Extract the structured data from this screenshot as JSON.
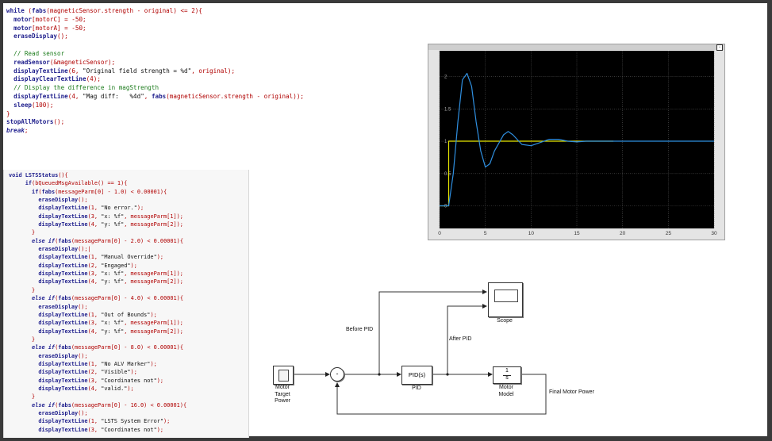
{
  "code_block_1": {
    "lines": [
      [
        {
          "t": "while",
          "c": "kw"
        },
        {
          "t": " (",
          "c": "op"
        },
        {
          "t": "fabs",
          "c": "fn"
        },
        {
          "t": "(magneticSensor.strength - original) <= ",
          "c": "op"
        },
        {
          "t": "2",
          "c": "num"
        },
        {
          "t": "){",
          "c": "op"
        }
      ],
      [
        {
          "t": "  motor",
          "c": "fn"
        },
        {
          "t": "[motorC]",
          "c": "op"
        },
        {
          "t": " = -",
          "c": "op"
        },
        {
          "t": "50",
          "c": "num"
        },
        {
          "t": ";",
          "c": "op"
        }
      ],
      [
        {
          "t": "  motor",
          "c": "fn"
        },
        {
          "t": "[motorA]",
          "c": "op"
        },
        {
          "t": " = -",
          "c": "op"
        },
        {
          "t": "50",
          "c": "num"
        },
        {
          "t": ";",
          "c": "op"
        }
      ],
      [
        {
          "t": "  eraseDisplay",
          "c": "fn"
        },
        {
          "t": "();",
          "c": "op"
        }
      ],
      [
        {
          "t": "",
          "c": "op"
        }
      ],
      [
        {
          "t": "  // Read sensor",
          "c": "cm"
        }
      ],
      [
        {
          "t": "  readSensor",
          "c": "fn"
        },
        {
          "t": "(&magneticSensor);",
          "c": "op"
        }
      ],
      [
        {
          "t": "  displayTextLine",
          "c": "fn"
        },
        {
          "t": "(",
          "c": "op"
        },
        {
          "t": "6",
          "c": "num"
        },
        {
          "t": ", ",
          "c": "op"
        },
        {
          "t": "\"Original field strength = %d\"",
          "c": "str"
        },
        {
          "t": ", original);",
          "c": "op"
        }
      ],
      [
        {
          "t": "  displayClearTextLine",
          "c": "fn"
        },
        {
          "t": "(",
          "c": "op"
        },
        {
          "t": "4",
          "c": "num"
        },
        {
          "t": ");",
          "c": "op"
        }
      ],
      [
        {
          "t": "  // Display the difference in magStrength",
          "c": "cm"
        }
      ],
      [
        {
          "t": "  displayTextLine",
          "c": "fn"
        },
        {
          "t": "(",
          "c": "op"
        },
        {
          "t": "4",
          "c": "num"
        },
        {
          "t": ", ",
          "c": "op"
        },
        {
          "t": "\"Mag diff:   %4d\"",
          "c": "str"
        },
        {
          "t": ", ",
          "c": "op"
        },
        {
          "t": "fabs",
          "c": "fn"
        },
        {
          "t": "(magneticSensor.strength - original));",
          "c": "op"
        }
      ],
      [
        {
          "t": "  sleep",
          "c": "fn"
        },
        {
          "t": "(",
          "c": "op"
        },
        {
          "t": "100",
          "c": "num"
        },
        {
          "t": ");",
          "c": "op"
        }
      ],
      [
        {
          "t": "}",
          "c": "op"
        }
      ],
      [
        {
          "t": "stopAllMotors",
          "c": "fn"
        },
        {
          "t": "();",
          "c": "op"
        }
      ],
      [
        {
          "t": "break",
          "c": "kwi"
        },
        {
          "t": ";",
          "c": "op"
        }
      ]
    ]
  },
  "code_block_2": {
    "lines": [
      [
        {
          "t": "void ",
          "c": "kw"
        },
        {
          "t": "LSTSStatus",
          "c": "fn"
        },
        {
          "t": "(){",
          "c": "op"
        }
      ],
      [
        {
          "t": "     if",
          "c": "kw"
        },
        {
          "t": "(bQueuedMsgAvailable() == ",
          "c": "op"
        },
        {
          "t": "1",
          "c": "num"
        },
        {
          "t": "){",
          "c": "op"
        }
      ],
      [
        {
          "t": "       if",
          "c": "kw"
        },
        {
          "t": "(",
          "c": "op"
        },
        {
          "t": "fabs",
          "c": "fn"
        },
        {
          "t": "(messageParm[",
          "c": "op"
        },
        {
          "t": "0",
          "c": "num"
        },
        {
          "t": "] - ",
          "c": "op"
        },
        {
          "t": "1.0",
          "c": "num"
        },
        {
          "t": ") < ",
          "c": "op"
        },
        {
          "t": "0.00001",
          "c": "num"
        },
        {
          "t": "){",
          "c": "op"
        }
      ],
      [
        {
          "t": "         eraseDisplay",
          "c": "fn"
        },
        {
          "t": "();",
          "c": "op"
        }
      ],
      [
        {
          "t": "         displayTextLine",
          "c": "fn"
        },
        {
          "t": "(",
          "c": "op"
        },
        {
          "t": "1",
          "c": "num"
        },
        {
          "t": ", ",
          "c": "op"
        },
        {
          "t": "\"No error.\"",
          "c": "str"
        },
        {
          "t": ");",
          "c": "op"
        }
      ],
      [
        {
          "t": "         displayTextLine",
          "c": "fn"
        },
        {
          "t": "(",
          "c": "op"
        },
        {
          "t": "3",
          "c": "num"
        },
        {
          "t": ", ",
          "c": "op"
        },
        {
          "t": "\"x: %f\"",
          "c": "str"
        },
        {
          "t": ", messageParm[",
          "c": "op"
        },
        {
          "t": "1",
          "c": "num"
        },
        {
          "t": "]);",
          "c": "op"
        }
      ],
      [
        {
          "t": "         displayTextLine",
          "c": "fn"
        },
        {
          "t": "(",
          "c": "op"
        },
        {
          "t": "4",
          "c": "num"
        },
        {
          "t": ", ",
          "c": "op"
        },
        {
          "t": "\"y: %f\"",
          "c": "str"
        },
        {
          "t": ", messageParm[",
          "c": "op"
        },
        {
          "t": "2",
          "c": "num"
        },
        {
          "t": "]);",
          "c": "op"
        }
      ],
      [
        {
          "t": "       }",
          "c": "op"
        }
      ],
      [
        {
          "t": "       else if",
          "c": "kwi"
        },
        {
          "t": "(",
          "c": "op"
        },
        {
          "t": "fabs",
          "c": "fn"
        },
        {
          "t": "(messageParm[",
          "c": "op"
        },
        {
          "t": "0",
          "c": "num"
        },
        {
          "t": "] - ",
          "c": "op"
        },
        {
          "t": "2.0",
          "c": "num"
        },
        {
          "t": ") < ",
          "c": "op"
        },
        {
          "t": "0.00001",
          "c": "num"
        },
        {
          "t": "){",
          "c": "op"
        }
      ],
      [
        {
          "t": "         eraseDisplay",
          "c": "fn"
        },
        {
          "t": "();|",
          "c": "op"
        }
      ],
      [
        {
          "t": "         displayTextLine",
          "c": "fn"
        },
        {
          "t": "(",
          "c": "op"
        },
        {
          "t": "1",
          "c": "num"
        },
        {
          "t": ", ",
          "c": "op"
        },
        {
          "t": "\"Manual Override\"",
          "c": "str"
        },
        {
          "t": ");",
          "c": "op"
        }
      ],
      [
        {
          "t": "         displayTextLine",
          "c": "fn"
        },
        {
          "t": "(",
          "c": "op"
        },
        {
          "t": "2",
          "c": "num"
        },
        {
          "t": ", ",
          "c": "op"
        },
        {
          "t": "\"Engaged\"",
          "c": "str"
        },
        {
          "t": ");",
          "c": "op"
        }
      ],
      [
        {
          "t": "         displayTextLine",
          "c": "fn"
        },
        {
          "t": "(",
          "c": "op"
        },
        {
          "t": "3",
          "c": "num"
        },
        {
          "t": ", ",
          "c": "op"
        },
        {
          "t": "\"x: %f\"",
          "c": "str"
        },
        {
          "t": ", messageParm[",
          "c": "op"
        },
        {
          "t": "1",
          "c": "num"
        },
        {
          "t": "]);",
          "c": "op"
        }
      ],
      [
        {
          "t": "         displayTextLine",
          "c": "fn"
        },
        {
          "t": "(",
          "c": "op"
        },
        {
          "t": "4",
          "c": "num"
        },
        {
          "t": ", ",
          "c": "op"
        },
        {
          "t": "\"y: %f\"",
          "c": "str"
        },
        {
          "t": ", messageParm[",
          "c": "op"
        },
        {
          "t": "2",
          "c": "num"
        },
        {
          "t": "]);",
          "c": "op"
        }
      ],
      [
        {
          "t": "       }",
          "c": "op"
        }
      ],
      [
        {
          "t": "       else if",
          "c": "kwi"
        },
        {
          "t": "(",
          "c": "op"
        },
        {
          "t": "fabs",
          "c": "fn"
        },
        {
          "t": "(messageParm[",
          "c": "op"
        },
        {
          "t": "0",
          "c": "num"
        },
        {
          "t": "] - ",
          "c": "op"
        },
        {
          "t": "4.0",
          "c": "num"
        },
        {
          "t": ") < ",
          "c": "op"
        },
        {
          "t": "0.00001",
          "c": "num"
        },
        {
          "t": "){",
          "c": "op"
        }
      ],
      [
        {
          "t": "         eraseDisplay",
          "c": "fn"
        },
        {
          "t": "();",
          "c": "op"
        }
      ],
      [
        {
          "t": "         displayTextLine",
          "c": "fn"
        },
        {
          "t": "(",
          "c": "op"
        },
        {
          "t": "1",
          "c": "num"
        },
        {
          "t": ", ",
          "c": "op"
        },
        {
          "t": "\"Out of Bounds\"",
          "c": "str"
        },
        {
          "t": ");",
          "c": "op"
        }
      ],
      [
        {
          "t": "         displayTextLine",
          "c": "fn"
        },
        {
          "t": "(",
          "c": "op"
        },
        {
          "t": "3",
          "c": "num"
        },
        {
          "t": ", ",
          "c": "op"
        },
        {
          "t": "\"x: %f\"",
          "c": "str"
        },
        {
          "t": ", messageParm[",
          "c": "op"
        },
        {
          "t": "1",
          "c": "num"
        },
        {
          "t": "]);",
          "c": "op"
        }
      ],
      [
        {
          "t": "         displayTextLine",
          "c": "fn"
        },
        {
          "t": "(",
          "c": "op"
        },
        {
          "t": "4",
          "c": "num"
        },
        {
          "t": ", ",
          "c": "op"
        },
        {
          "t": "\"y: %f\"",
          "c": "str"
        },
        {
          "t": ", messageParm[",
          "c": "op"
        },
        {
          "t": "2",
          "c": "num"
        },
        {
          "t": "]);",
          "c": "op"
        }
      ],
      [
        {
          "t": "       }",
          "c": "op"
        }
      ],
      [
        {
          "t": "       else if",
          "c": "kwi"
        },
        {
          "t": "(",
          "c": "op"
        },
        {
          "t": "fabs",
          "c": "fn"
        },
        {
          "t": "(messageParm[",
          "c": "op"
        },
        {
          "t": "0",
          "c": "num"
        },
        {
          "t": "] - ",
          "c": "op"
        },
        {
          "t": "8.0",
          "c": "num"
        },
        {
          "t": ") < ",
          "c": "op"
        },
        {
          "t": "0.00001",
          "c": "num"
        },
        {
          "t": "){",
          "c": "op"
        }
      ],
      [
        {
          "t": "         eraseDisplay",
          "c": "fn"
        },
        {
          "t": "();",
          "c": "op"
        }
      ],
      [
        {
          "t": "         displayTextLine",
          "c": "fn"
        },
        {
          "t": "(",
          "c": "op"
        },
        {
          "t": "1",
          "c": "num"
        },
        {
          "t": ", ",
          "c": "op"
        },
        {
          "t": "\"No ALV Marker\"",
          "c": "str"
        },
        {
          "t": ");",
          "c": "op"
        }
      ],
      [
        {
          "t": "         displayTextLine",
          "c": "fn"
        },
        {
          "t": "(",
          "c": "op"
        },
        {
          "t": "2",
          "c": "num"
        },
        {
          "t": ", ",
          "c": "op"
        },
        {
          "t": "\"Visible\"",
          "c": "str"
        },
        {
          "t": ");",
          "c": "op"
        }
      ],
      [
        {
          "t": "         displayTextLine",
          "c": "fn"
        },
        {
          "t": "(",
          "c": "op"
        },
        {
          "t": "3",
          "c": "num"
        },
        {
          "t": ", ",
          "c": "op"
        },
        {
          "t": "\"Coordinates not\"",
          "c": "str"
        },
        {
          "t": ");",
          "c": "op"
        }
      ],
      [
        {
          "t": "         displayTextLine",
          "c": "fn"
        },
        {
          "t": "(",
          "c": "op"
        },
        {
          "t": "4",
          "c": "num"
        },
        {
          "t": ", ",
          "c": "op"
        },
        {
          "t": "\"valid.\"",
          "c": "str"
        },
        {
          "t": ");",
          "c": "op"
        }
      ],
      [
        {
          "t": "       }",
          "c": "op"
        }
      ],
      [
        {
          "t": "       else if",
          "c": "kwi"
        },
        {
          "t": "(",
          "c": "op"
        },
        {
          "t": "fabs",
          "c": "fn"
        },
        {
          "t": "(messageParm[",
          "c": "op"
        },
        {
          "t": "0",
          "c": "num"
        },
        {
          "t": "] - ",
          "c": "op"
        },
        {
          "t": "16.0",
          "c": "num"
        },
        {
          "t": ") < ",
          "c": "op"
        },
        {
          "t": "0.00001",
          "c": "num"
        },
        {
          "t": "){",
          "c": "op"
        }
      ],
      [
        {
          "t": "         eraseDisplay",
          "c": "fn"
        },
        {
          "t": "();",
          "c": "op"
        }
      ],
      [
        {
          "t": "         displayTextLine",
          "c": "fn"
        },
        {
          "t": "(",
          "c": "op"
        },
        {
          "t": "1",
          "c": "num"
        },
        {
          "t": ", ",
          "c": "op"
        },
        {
          "t": "\"LSTS System Error\"",
          "c": "str"
        },
        {
          "t": ");",
          "c": "op"
        }
      ],
      [
        {
          "t": "         displayTextLine",
          "c": "fn"
        },
        {
          "t": "(",
          "c": "op"
        },
        {
          "t": "3",
          "c": "num"
        },
        {
          "t": ", ",
          "c": "op"
        },
        {
          "t": "\"Coordinates not\"",
          "c": "str"
        },
        {
          "t": ");",
          "c": "op"
        }
      ]
    ]
  },
  "colors": {
    "scope_bg": "#000000",
    "grid": "#5a5a5a",
    "reference_line": "#e6e600",
    "response_line": "#2f8fe0"
  },
  "chart_data": {
    "type": "line",
    "x_ticks": [
      "0",
      "5",
      "10",
      "15",
      "20",
      "25",
      "30"
    ],
    "y_ticks": [
      "0",
      "0.5",
      "1",
      "1.5",
      "2"
    ],
    "xlim": [
      0,
      30
    ],
    "ylim": [
      -0.35,
      2.4
    ],
    "grid": true,
    "series": [
      {
        "color_key": "reference_line",
        "x": [
          0,
          1,
          1,
          19
        ],
        "y": [
          0,
          0,
          1,
          1
        ]
      },
      {
        "color_key": "response_line",
        "x": [
          0,
          1,
          1.5,
          2,
          2.5,
          3,
          3.5,
          4,
          4.5,
          5,
          5.5,
          6,
          7,
          7.5,
          8,
          9,
          10,
          11,
          12,
          13,
          14,
          15,
          16,
          17,
          18,
          19,
          20,
          22,
          25,
          28,
          30
        ],
        "y": [
          0,
          0,
          0.5,
          1.3,
          1.95,
          2.05,
          1.85,
          1.3,
          0.85,
          0.6,
          0.65,
          0.85,
          1.1,
          1.15,
          1.1,
          0.95,
          0.93,
          0.98,
          1.03,
          1.03,
          1.0,
          0.99,
          1.0,
          1.0,
          1.0,
          1.0,
          1.0,
          1.0,
          1.0,
          1.0,
          1.0
        ]
      }
    ]
  },
  "scope_window": {
    "corner_button": "▫"
  },
  "diagram": {
    "source_block": {
      "label": "Motor\nTarget\nPower"
    },
    "sum_block": {
      "sign": "-"
    },
    "pid_block": {
      "inner": "PID(s)",
      "label": "PID"
    },
    "tf_block": {
      "num": "1",
      "den": "s",
      "label": "Motor\nModel"
    },
    "scope_block": {
      "label": "Scope"
    },
    "signal_before_pid": "Before PID",
    "signal_after_pid": "After PID",
    "signal_output": "Final Motor Power"
  }
}
